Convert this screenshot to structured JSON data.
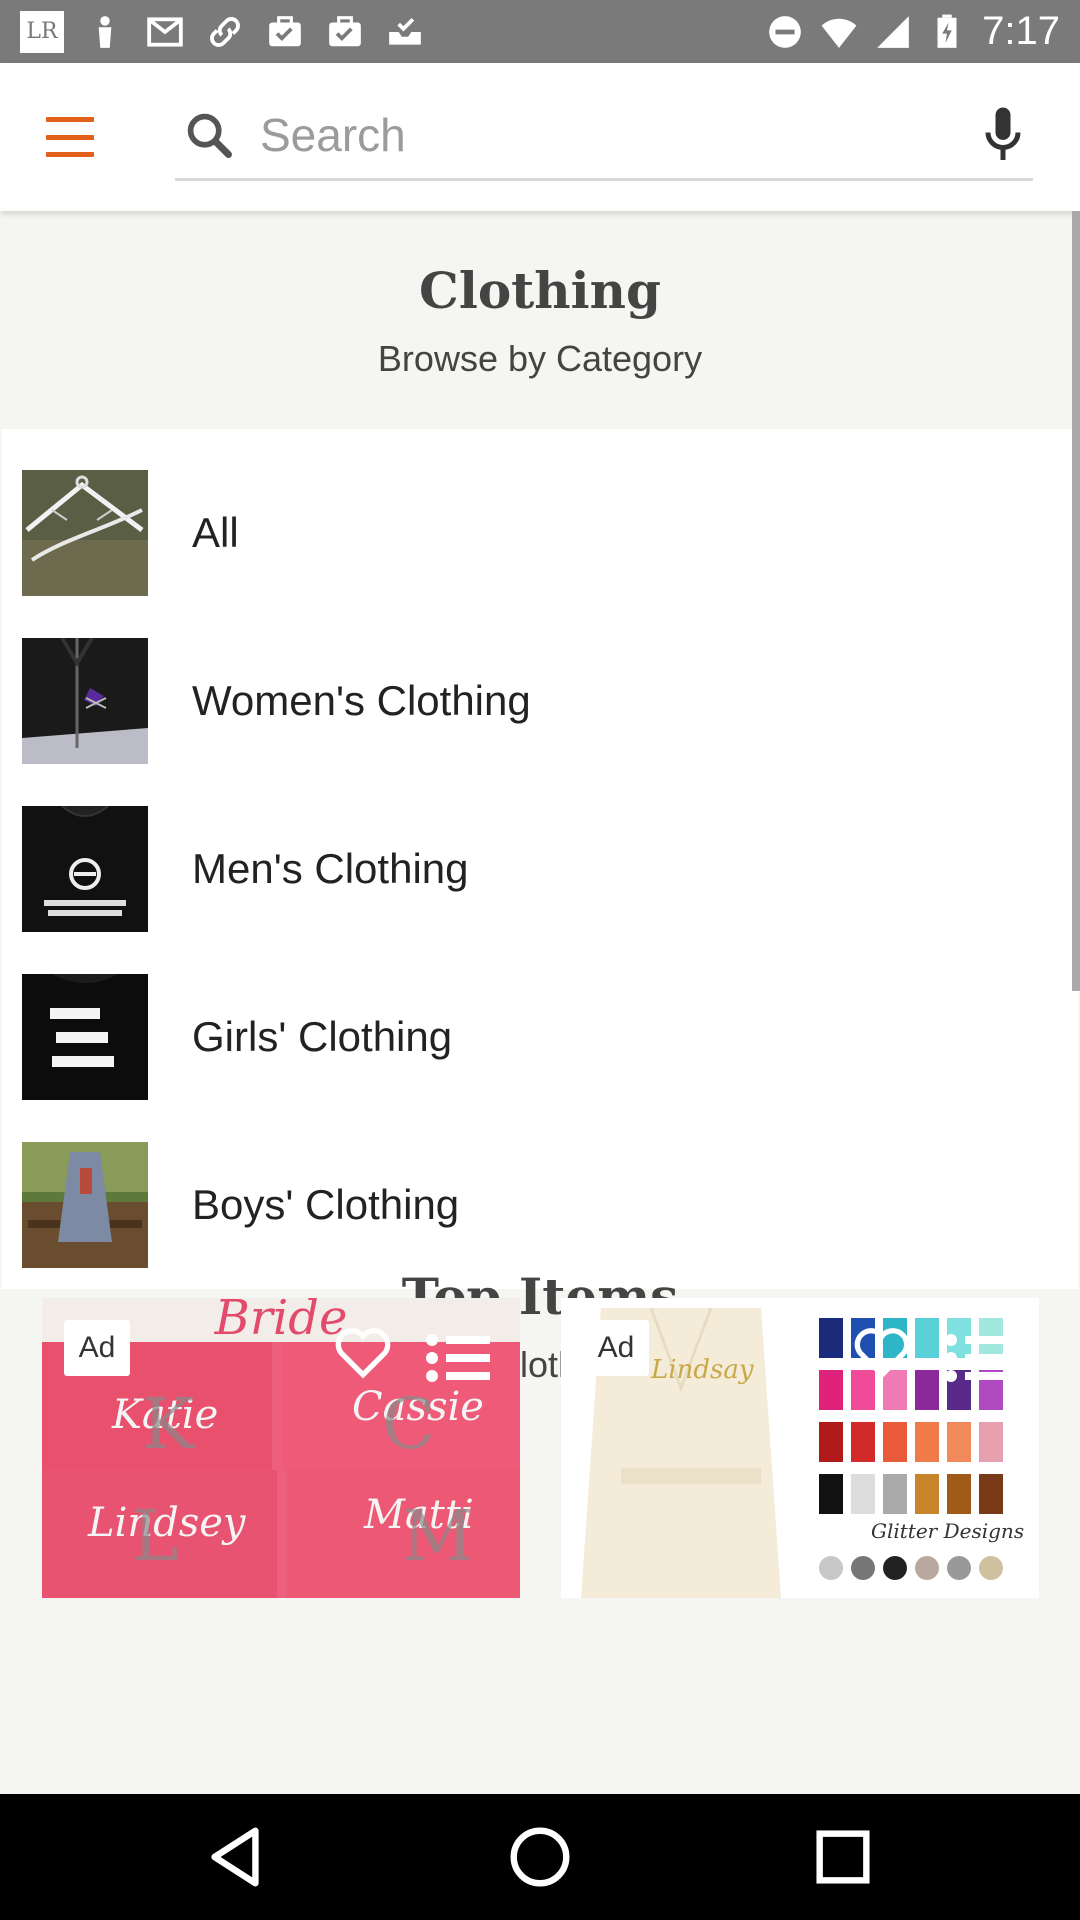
{
  "status_bar": {
    "time": "7:17",
    "left_icons": [
      "lr-icon",
      "person-icon",
      "gmail-icon",
      "link-icon",
      "briefcase-check-icon",
      "briefcase-check-icon",
      "inbox-check-icon"
    ],
    "lr_label": "LR",
    "right_icons": [
      "do-not-disturb-icon",
      "wifi-icon",
      "signal-icon",
      "battery-charging-icon"
    ]
  },
  "app_bar": {
    "menu_icon": "hamburger-menu-icon",
    "search_placeholder": "Search",
    "search_value": "",
    "mic_icon": "microphone-icon",
    "accent_color": "#e1601a"
  },
  "category_section": {
    "title": "Clothing",
    "subtitle": "Browse by Category",
    "items": [
      {
        "label": "All"
      },
      {
        "label": "Women's Clothing"
      },
      {
        "label": "Men's Clothing"
      },
      {
        "label": "Girls' Clothing"
      },
      {
        "label": "Boys' Clothing"
      }
    ]
  },
  "top_items": {
    "title": "Top Items",
    "subtitle": "In Clothing",
    "cards": [
      {
        "badge": "Ad",
        "image_text": [
          "Bride",
          "Katie",
          "Cassie",
          "Lindsey",
          "Matti"
        ]
      },
      {
        "badge": "Ad",
        "image_text": [
          "Lindsay",
          "Glitter Designs"
        ]
      }
    ]
  },
  "nav_bar": {
    "buttons": [
      "back-icon",
      "home-icon",
      "recents-icon"
    ]
  }
}
